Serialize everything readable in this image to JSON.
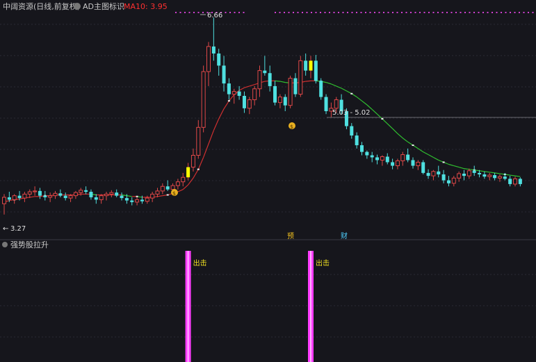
{
  "header": {
    "title": "中阔资源(日线,前复权)",
    "indicator_name": "AD主图标识",
    "ma_label": "MA10: 3.95"
  },
  "lower_panel": {
    "title": "强势股拉升",
    "signal_label": "出击"
  },
  "annotations": {
    "high_label": "6.66",
    "low_label": "3.27",
    "range_label": "5.03 - 5.02",
    "tag_1": "预",
    "tag_2": "财",
    "coin_symbol": "$"
  },
  "colors": {
    "background": "#16161c",
    "up": "#e04848",
    "down": "#4fe0e0",
    "ma_up": "#d03030",
    "ma_down": "#30c030",
    "signal_bar": "#ff3cff",
    "signal_candle": "#ffff00",
    "text": "#c8c8c8",
    "ma_text": "#ff3030"
  },
  "chart_data": {
    "type": "candlestick",
    "ylim": [
      3.0,
      7.0
    ],
    "ohlc": [
      [
        3.4,
        3.52,
        3.27,
        3.48
      ],
      [
        3.48,
        3.55,
        3.42,
        3.45
      ],
      [
        3.45,
        3.52,
        3.4,
        3.5
      ],
      [
        3.5,
        3.56,
        3.44,
        3.47
      ],
      [
        3.47,
        3.55,
        3.42,
        3.52
      ],
      [
        3.52,
        3.58,
        3.47,
        3.55
      ],
      [
        3.55,
        3.62,
        3.5,
        3.56
      ],
      [
        3.56,
        3.6,
        3.46,
        3.5
      ],
      [
        3.5,
        3.56,
        3.44,
        3.48
      ],
      [
        3.48,
        3.54,
        3.42,
        3.5
      ],
      [
        3.5,
        3.56,
        3.46,
        3.53
      ],
      [
        3.53,
        3.58,
        3.48,
        3.5
      ],
      [
        3.5,
        3.54,
        3.44,
        3.47
      ],
      [
        3.47,
        3.52,
        3.42,
        3.5
      ],
      [
        3.5,
        3.56,
        3.46,
        3.54
      ],
      [
        3.54,
        3.6,
        3.5,
        3.57
      ],
      [
        3.57,
        3.62,
        3.52,
        3.55
      ],
      [
        3.55,
        3.58,
        3.45,
        3.48
      ],
      [
        3.48,
        3.52,
        3.4,
        3.45
      ],
      [
        3.45,
        3.52,
        3.4,
        3.5
      ],
      [
        3.5,
        3.55,
        3.44,
        3.52
      ],
      [
        3.52,
        3.57,
        3.48,
        3.54
      ],
      [
        3.54,
        3.58,
        3.48,
        3.5
      ],
      [
        3.5,
        3.54,
        3.44,
        3.47
      ],
      [
        3.47,
        3.52,
        3.4,
        3.44
      ],
      [
        3.44,
        3.48,
        3.38,
        3.42
      ],
      [
        3.42,
        3.48,
        3.38,
        3.45
      ],
      [
        3.45,
        3.5,
        3.4,
        3.43
      ],
      [
        3.43,
        3.5,
        3.4,
        3.47
      ],
      [
        3.47,
        3.55,
        3.42,
        3.52
      ],
      [
        3.52,
        3.6,
        3.48,
        3.56
      ],
      [
        3.56,
        3.66,
        3.52,
        3.62
      ],
      [
        3.62,
        3.7,
        3.56,
        3.58
      ],
      [
        3.58,
        3.66,
        3.54,
        3.63
      ],
      [
        3.63,
        3.72,
        3.58,
        3.68
      ],
      [
        3.68,
        3.8,
        3.62,
        3.74
      ],
      [
        3.74,
        3.94,
        3.7,
        3.88
      ],
      [
        3.88,
        4.15,
        3.82,
        4.05
      ],
      [
        4.05,
        4.6,
        4.0,
        4.48
      ],
      [
        4.48,
        5.6,
        4.4,
        5.48
      ],
      [
        5.48,
        6.1,
        5.2,
        6.0
      ],
      [
        6.0,
        6.66,
        5.7,
        5.85
      ],
      [
        5.85,
        5.95,
        5.4,
        5.6
      ],
      [
        5.6,
        5.8,
        5.1,
        5.25
      ],
      [
        5.25,
        5.35,
        4.95,
        5.05
      ],
      [
        5.05,
        5.15,
        4.88,
        5.1
      ],
      [
        5.1,
        5.2,
        4.95,
        5.02
      ],
      [
        5.02,
        5.1,
        4.72,
        4.8
      ],
      [
        4.8,
        5.0,
        4.7,
        4.95
      ],
      [
        4.95,
        5.2,
        4.85,
        5.15
      ],
      [
        5.15,
        5.6,
        5.0,
        5.5
      ],
      [
        5.5,
        5.8,
        5.4,
        5.45
      ],
      [
        5.45,
        5.6,
        5.1,
        5.2
      ],
      [
        5.2,
        5.3,
        4.85,
        4.9
      ],
      [
        4.9,
        5.05,
        4.8,
        5.0
      ],
      [
        5.0,
        5.05,
        4.75,
        4.85
      ],
      [
        4.85,
        5.4,
        4.8,
        5.35
      ],
      [
        5.35,
        5.45,
        5.0,
        5.05
      ],
      [
        5.05,
        5.8,
        5.0,
        5.7
      ],
      [
        5.7,
        5.85,
        5.4,
        5.5
      ],
      [
        5.5,
        5.8,
        5.35,
        5.7
      ],
      [
        5.7,
        5.82,
        5.25,
        5.3
      ],
      [
        5.3,
        5.35,
        4.95,
        5.0
      ],
      [
        5.0,
        5.05,
        4.7,
        4.75
      ],
      [
        4.75,
        4.9,
        4.65,
        4.8
      ],
      [
        4.8,
        5.0,
        4.72,
        4.95
      ],
      [
        4.95,
        5.05,
        4.7,
        4.75
      ],
      [
        4.75,
        4.8,
        4.45,
        4.5
      ],
      [
        4.5,
        4.55,
        4.3,
        4.35
      ],
      [
        4.35,
        4.4,
        4.15,
        4.2
      ],
      [
        4.2,
        4.25,
        4.05,
        4.1
      ],
      [
        4.1,
        4.12,
        4.0,
        4.05
      ],
      [
        4.05,
        4.1,
        3.95,
        4.02
      ],
      [
        4.02,
        4.06,
        3.92,
        3.98
      ],
      [
        3.98,
        4.05,
        3.9,
        4.03
      ],
      [
        4.03,
        4.08,
        3.92,
        3.95
      ],
      [
        3.95,
        4.0,
        3.85,
        3.9
      ],
      [
        3.9,
        4.0,
        3.85,
        3.97
      ],
      [
        3.97,
        4.1,
        3.9,
        4.06
      ],
      [
        4.06,
        4.15,
        3.95,
        3.98
      ],
      [
        3.98,
        4.02,
        3.86,
        3.9
      ],
      [
        3.9,
        3.98,
        3.84,
        3.95
      ],
      [
        3.95,
        3.98,
        3.78,
        3.8
      ],
      [
        3.8,
        3.85,
        3.72,
        3.76
      ],
      [
        3.76,
        3.84,
        3.7,
        3.82
      ],
      [
        3.82,
        3.9,
        3.74,
        3.78
      ],
      [
        3.78,
        3.84,
        3.66,
        3.7
      ],
      [
        3.7,
        3.76,
        3.62,
        3.66
      ],
      [
        3.66,
        3.76,
        3.62,
        3.73
      ],
      [
        3.73,
        3.82,
        3.68,
        3.79
      ],
      [
        3.79,
        3.84,
        3.7,
        3.76
      ],
      [
        3.76,
        3.86,
        3.72,
        3.83
      ],
      [
        3.83,
        3.9,
        3.76,
        3.8
      ],
      [
        3.8,
        3.84,
        3.74,
        3.78
      ],
      [
        3.78,
        3.82,
        3.72,
        3.75
      ],
      [
        3.75,
        3.8,
        3.7,
        3.77
      ],
      [
        3.77,
        3.8,
        3.7,
        3.73
      ],
      [
        3.73,
        3.78,
        3.68,
        3.75
      ],
      [
        3.75,
        3.8,
        3.7,
        3.72
      ],
      [
        3.72,
        3.76,
        3.62,
        3.65
      ],
      [
        3.65,
        3.75,
        3.62,
        3.72
      ],
      [
        3.72,
        3.74,
        3.62,
        3.65
      ]
    ],
    "ma10": [
      3.42,
      3.44,
      3.45,
      3.46,
      3.47,
      3.48,
      3.49,
      3.49,
      3.5,
      3.5,
      3.51,
      3.51,
      3.51,
      3.51,
      3.51,
      3.52,
      3.52,
      3.52,
      3.51,
      3.51,
      3.51,
      3.51,
      3.51,
      3.51,
      3.5,
      3.49,
      3.49,
      3.48,
      3.48,
      3.48,
      3.49,
      3.5,
      3.51,
      3.53,
      3.55,
      3.58,
      3.64,
      3.73,
      3.85,
      4.02,
      4.22,
      4.43,
      4.62,
      4.79,
      4.93,
      5.04,
      5.12,
      5.17,
      5.2,
      5.23,
      5.26,
      5.29,
      5.3,
      5.3,
      5.29,
      5.27,
      5.26,
      5.26,
      5.27,
      5.29,
      5.3,
      5.3,
      5.29,
      5.27,
      5.24,
      5.2,
      5.16,
      5.11,
      5.06,
      5.0,
      4.93,
      4.86,
      4.78,
      4.7,
      4.62,
      4.54,
      4.46,
      4.38,
      4.31,
      4.25,
      4.2,
      4.15,
      4.1,
      4.06,
      4.02,
      3.98,
      3.95,
      3.92,
      3.9,
      3.88,
      3.86,
      3.85,
      3.84,
      3.83,
      3.82,
      3.81,
      3.8,
      3.79,
      3.78,
      3.77,
      3.76,
      3.75,
      3.74
    ],
    "signals": [
      36,
      60
    ]
  }
}
